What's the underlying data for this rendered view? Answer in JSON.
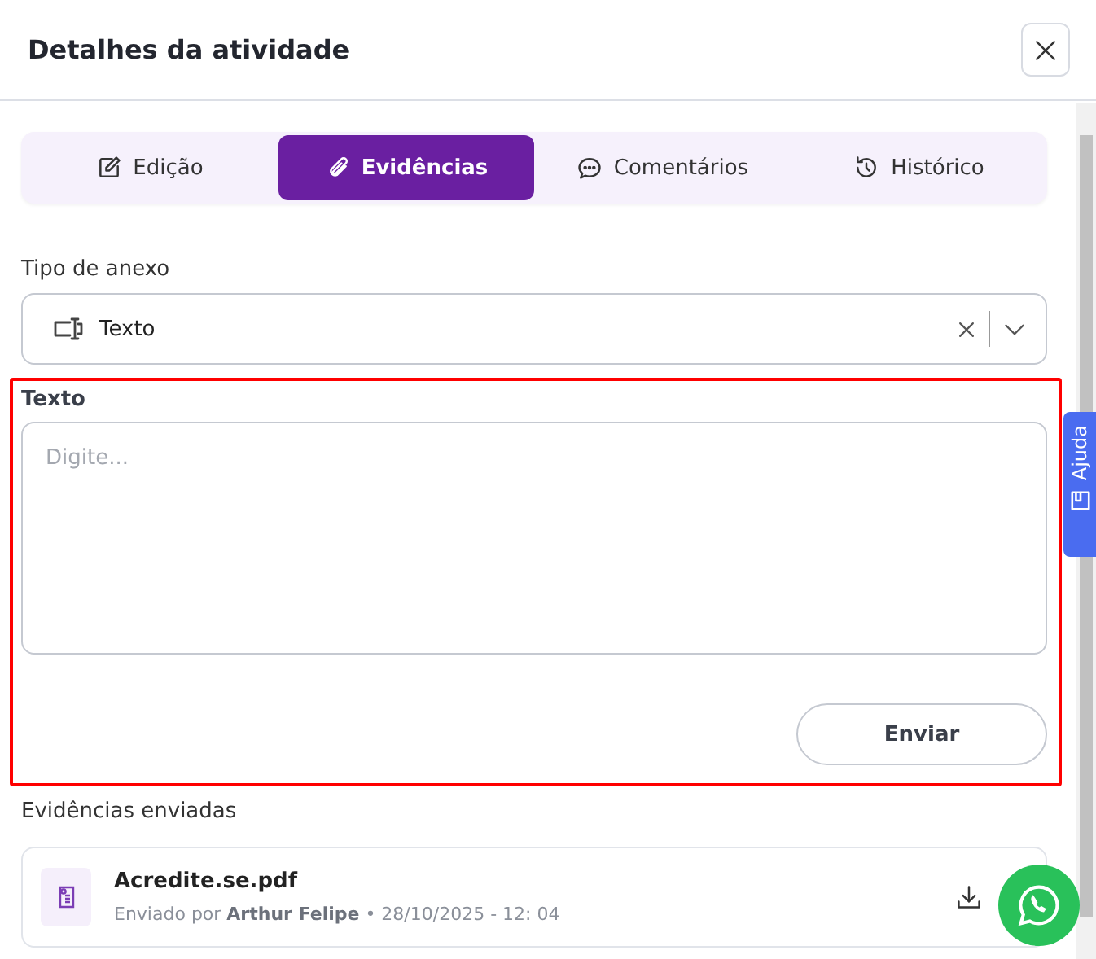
{
  "window": {
    "title": "Detalhes da atividade"
  },
  "tabs": [
    {
      "label": "Edição",
      "kind": "edit",
      "selected": false
    },
    {
      "label": "Evidências",
      "kind": "clip",
      "selected": true
    },
    {
      "label": "Comentários",
      "kind": "chat",
      "selected": false
    },
    {
      "label": "Histórico",
      "kind": "history",
      "selected": false
    }
  ],
  "attachment_type": {
    "label": "Tipo de anexo",
    "value": "Texto"
  },
  "text_field": {
    "label": "Texto",
    "placeholder": "Digite..."
  },
  "send_button": "Enviar",
  "sent_section": {
    "title": "Evidências enviadas",
    "items": [
      {
        "name": "Acredite.se.pdf",
        "meta": "Enviado por **Arthur Felipe** • 28/10/2025 - 12: 04"
      }
    ]
  },
  "help_tab": "Ajuda"
}
